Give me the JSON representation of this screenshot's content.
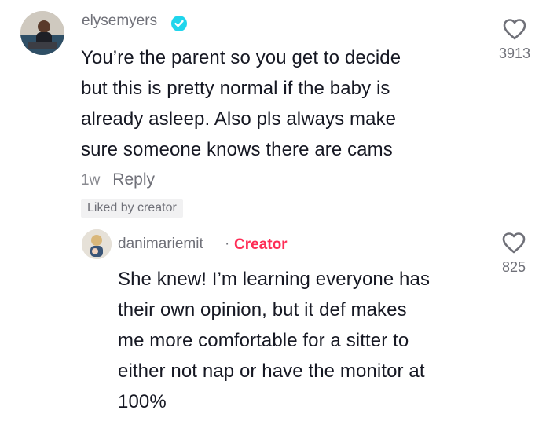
{
  "comments": [
    {
      "username": "elysemyers",
      "verified": true,
      "lines": [
        "You’re the parent so you get to decide",
        "but this is pretty normal if the baby is",
        "already asleep. Also pls always make",
        "sure someone knows there are cams"
      ],
      "likes": "3913",
      "time": "1w",
      "reply_label": "Reply",
      "badge": "Liked by creator",
      "icons": {
        "verified": "verified-badge-icon",
        "like": "heart-icon"
      }
    }
  ],
  "replies": [
    {
      "username": "danimariemit",
      "separator": "·",
      "tag": "Creator",
      "lines": [
        "She knew! I’m learning everyone has",
        "their own opinion, but it def makes",
        "me more comfortable for a sitter to",
        "either not nap or have the monitor at",
        "100%"
      ],
      "likes": "825",
      "icons": {
        "like": "heart-icon"
      }
    }
  ],
  "colors": {
    "text": "#161823",
    "muted": "#6f7078",
    "verified_blue": "#20d5ec",
    "creator_red": "#fe2c55",
    "badge_bg": "#f1f1f2"
  }
}
